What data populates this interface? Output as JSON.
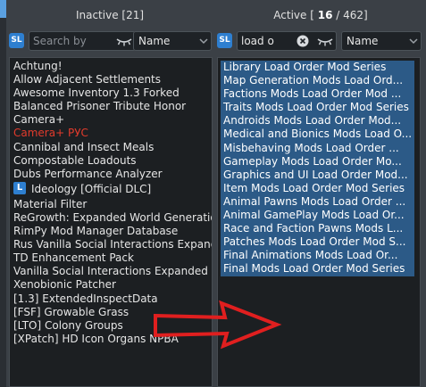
{
  "inactive": {
    "header_label": "Inactive [21]",
    "search_placeholder": "Search by",
    "search_value": "",
    "sort_value": "Name",
    "sl_icon": "SL",
    "mods": [
      {
        "name": "Achtung!",
        "status": "normal"
      },
      {
        "name": "Allow Adjacent Settlements",
        "status": "normal"
      },
      {
        "name": "Awesome Inventory 1.3 Forked",
        "status": "normal"
      },
      {
        "name": "Balanced Prisoner Tribute Honor",
        "status": "normal"
      },
      {
        "name": "Camera+",
        "status": "normal"
      },
      {
        "name": "Camera+ РУС",
        "status": "error"
      },
      {
        "name": "Cannibal and Insect Meals",
        "status": "normal"
      },
      {
        "name": "Compostable Loadouts",
        "status": "normal"
      },
      {
        "name": "Dubs Performance Analyzer",
        "status": "normal"
      },
      {
        "name": "Ideology [Official DLC]",
        "status": "dlc",
        "badge": "L"
      },
      {
        "name": "Material Filter",
        "status": "normal"
      },
      {
        "name": "ReGrowth: Expanded World Generation...",
        "status": "normal"
      },
      {
        "name": "RimPy Mod Manager Database",
        "status": "normal"
      },
      {
        "name": "Rus Vanilla Social Interactions Expanded",
        "status": "normal"
      },
      {
        "name": "TD Enhancement Pack",
        "status": "normal"
      },
      {
        "name": "Vanilla Social Interactions Expanded",
        "status": "normal"
      },
      {
        "name": "Xenobionic Patcher",
        "status": "normal"
      },
      {
        "name": "[1.3] ExtendedInspectData",
        "status": "normal"
      },
      {
        "name": "[FSF] Growable Grass",
        "status": "normal"
      },
      {
        "name": "[LTO] Colony Groups",
        "status": "normal"
      },
      {
        "name": "[XPatch] HD Icon Organs NPBA",
        "status": "normal"
      }
    ]
  },
  "active": {
    "header_prefix": "Active [ ",
    "header_count": "16",
    "header_suffix": " / 462]",
    "search_value": "load o",
    "sort_value": "Name",
    "sl_icon": "SL",
    "mods": [
      "Library Load Order Mod Series",
      "Map Generation Mods Load Ord...",
      "Factions Mods Load Order Mod ...",
      "Traits Mods Load Order Mod Series",
      "Androids Mods Load Order Mod...",
      "Medical and Bionics Mods Load O...",
      "Misbehaving Mods Load Order ...",
      "Gameplay Mods Load Order Mo...",
      "Graphics and UI Load Order Mod...",
      "Item Mods Load Order Mod Series",
      "Animal Pawns Mods Load Order ...",
      "Animal GamePlay Mods Load Or...",
      "Race and Faction Pawns Mods L...",
      "Patches Mods Load Order Mod S...",
      "Final Animations Mods Load Or...",
      "Final Mods Load Order Mod Series"
    ]
  },
  "icons": {
    "eye": "eye-closed-icon",
    "clear": "clear-icon",
    "dropdown": "chevron-down-icon",
    "arrow": "red-arrow-annotation"
  },
  "colors": {
    "error_text": "#e23b2c",
    "selection": "#2c5a87",
    "accent": "#2e7fd0",
    "annotation": "#e01f1f"
  }
}
